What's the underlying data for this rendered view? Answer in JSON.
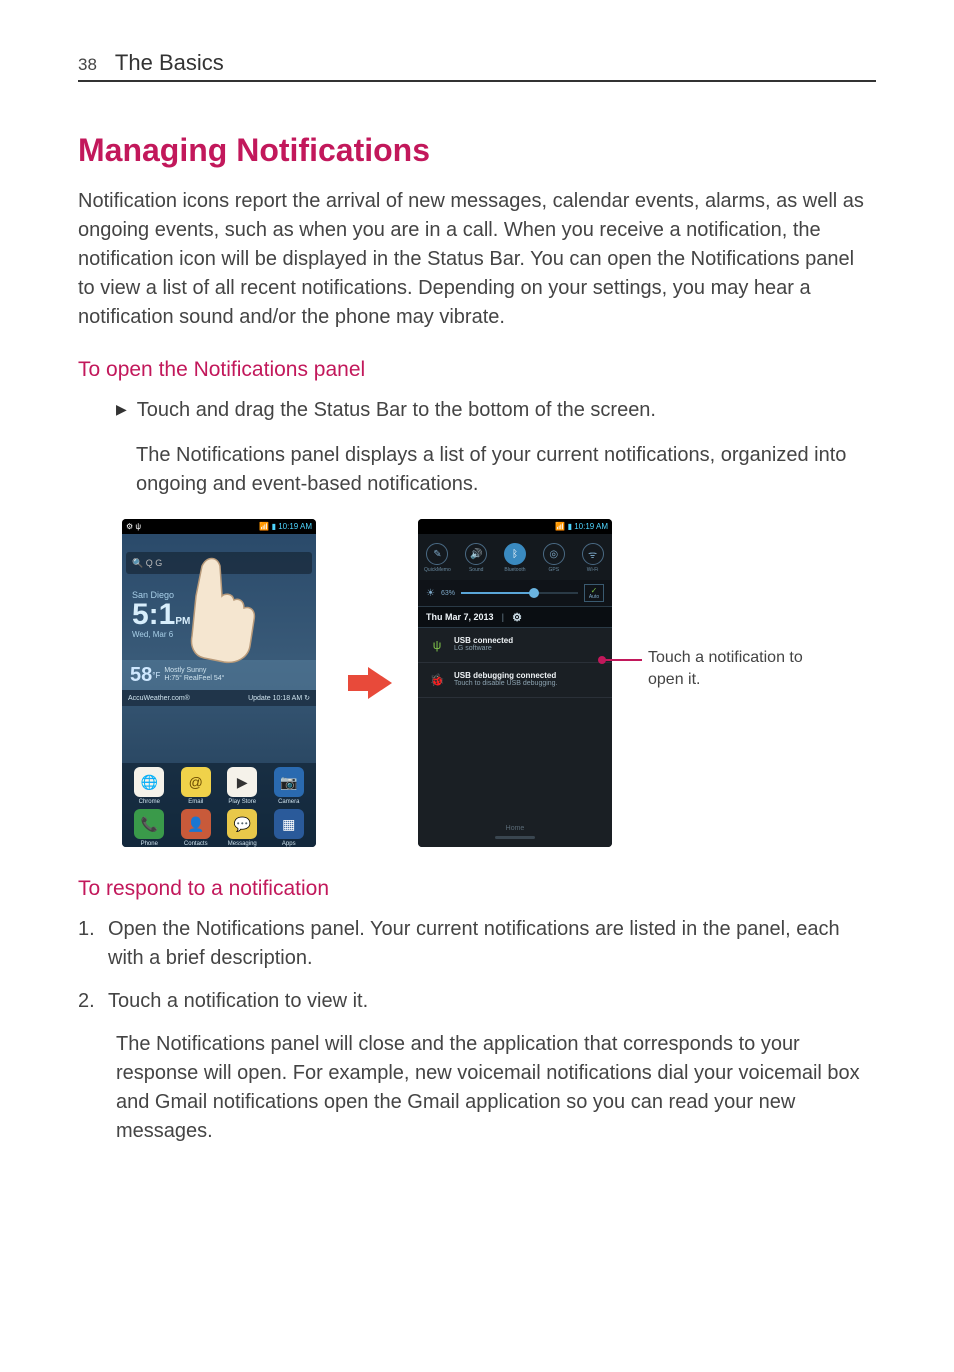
{
  "page": {
    "number": "38",
    "chapter": "The Basics"
  },
  "title": "Managing Notifications",
  "intro": "Notification icons report the arrival of new messages, calendar events, alarms, as well as ongoing events, such as when you are in a call. When you receive a notification, the notification icon will be displayed in the Status Bar. You can open the Notifications panel to view a list of all recent notifications. Depending on your settings, you may hear a notification sound and/or the phone may vibrate.",
  "section_open": {
    "heading": "To open the Notifications panel",
    "bullet": "Touch and drag the Status Bar to the bottom of the screen.",
    "followup": "The Notifications panel displays a list of your current notifications, organized into ongoing and event-based notifications."
  },
  "left_phone": {
    "statusbar_left": "⚙ ψ",
    "statusbar_right": "📶 ▮ 10:19 AM",
    "search_icons": "🔍  Q  G",
    "city": "San Diego",
    "time": "5:1",
    "ampm": "PM",
    "date": "Wed, Mar 6",
    "temp": "58",
    "temp_unit": "°F",
    "weather_desc": "Mostly Sunny",
    "weather_sub": "H:75° RealFeel 54°",
    "provider": "AccuWeather.com®",
    "update": "Update 10:18 AM ↻",
    "dock_top": [
      {
        "icon": "🌐",
        "label": "Chrome"
      },
      {
        "icon": "@",
        "label": "Email"
      },
      {
        "icon": "▶",
        "label": "Play Store"
      },
      {
        "icon": "📷",
        "label": "Camera"
      }
    ],
    "dock_bottom": [
      {
        "icon": "📞",
        "label": "Phone"
      },
      {
        "icon": "👤",
        "label": "Contacts"
      },
      {
        "icon": "💬",
        "label": "Messaging"
      },
      {
        "icon": "▦",
        "label": "Apps"
      }
    ]
  },
  "right_phone": {
    "statusbar_right": "📶 ▮ 10:19 AM",
    "qs": [
      {
        "icon": "✎",
        "label": "QuickMemo"
      },
      {
        "icon": "🔊",
        "label": "Sound"
      },
      {
        "icon": "ᛒ",
        "label": "Bluetooth"
      },
      {
        "icon": "◎",
        "label": "GPS"
      },
      {
        "icon": "ᯤ",
        "label": "Wi-Fi"
      }
    ],
    "brightness_pct": "63%",
    "auto_check": "✓",
    "auto_label": "Auto",
    "date_text": "Thu Mar 7, 2013",
    "notifs": [
      {
        "icon": "ψ",
        "title": "USB connected",
        "sub": "LG software"
      },
      {
        "icon": "🐞",
        "title": "USB debugging connected",
        "sub": "Touch to disable USB debugging."
      }
    ],
    "home_label": "Home"
  },
  "callout": "Touch a notification to open it.",
  "section_respond": {
    "heading": "To respond to a notification",
    "items": [
      {
        "num": "1.",
        "text": "Open the Notifications panel. Your current notifications are listed in the panel, each with a brief description."
      },
      {
        "num": "2.",
        "text": "Touch a notification to view it."
      }
    ],
    "followup": "The Notifications panel will close and the application that corresponds to your response will open. For example, new voicemail notifications dial your voicemail box and Gmail notifications open the Gmail application so you can read your new messages."
  }
}
